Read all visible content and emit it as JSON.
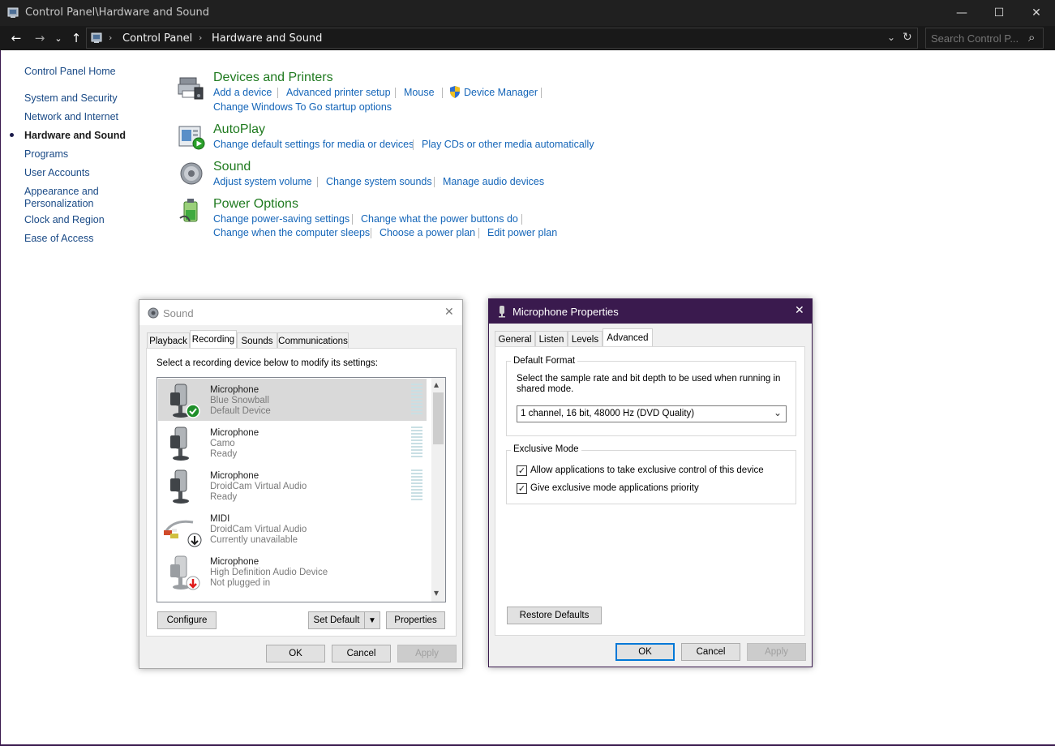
{
  "window": {
    "title": "Control Panel\\Hardware and Sound",
    "minimize_glyph": "—",
    "maximize_glyph": "☐",
    "close_glyph": "✕"
  },
  "addressbar": {
    "back_glyph": "←",
    "forward_glyph": "→",
    "recent_glyph": "⌄",
    "up_glyph": "↑",
    "crumbs": [
      "Control Panel",
      "Hardware and Sound"
    ],
    "crumb_sep": "›",
    "dropdown_glyph": "⌄",
    "refresh_glyph": "↻",
    "search_placeholder": "Search Control P...",
    "search_glyph": "⌕"
  },
  "nav": {
    "home": "Control Panel Home",
    "items": [
      "System and Security",
      "Network and Internet",
      "Hardware and Sound",
      "Programs",
      "User Accounts",
      "Appearance and",
      "Personalization",
      "Clock and Region",
      "Ease of Access"
    ]
  },
  "categories": {
    "devices": {
      "title": "Devices and Printers",
      "links": [
        "Add a device",
        "Advanced printer setup",
        "Mouse",
        "Device Manager",
        "Change Windows To Go startup options"
      ]
    },
    "autoplay": {
      "title": "AutoPlay",
      "links": [
        "Change default settings for media or devices",
        "Play CDs or other media automatically"
      ]
    },
    "sound": {
      "title": "Sound",
      "links": [
        "Adjust system volume",
        "Change system sounds",
        "Manage audio devices"
      ]
    },
    "power": {
      "title": "Power Options",
      "links": [
        "Change power-saving settings",
        "Change what the power buttons do",
        "Change when the computer sleeps",
        "Choose a power plan",
        "Edit power plan"
      ]
    }
  },
  "sound_dialog": {
    "title": "Sound",
    "close_glyph": "✕",
    "tabs": [
      "Playback",
      "Recording",
      "Sounds",
      "Communications"
    ],
    "instruction": "Select a recording device below to modify its settings:",
    "devices": [
      {
        "name": "Microphone",
        "desc": "Blue Snowball",
        "status": "Default Device"
      },
      {
        "name": "Microphone",
        "desc": "Camo",
        "status": "Ready"
      },
      {
        "name": "Microphone",
        "desc": "DroidCam Virtual Audio",
        "status": "Ready"
      },
      {
        "name": "MIDI",
        "desc": "DroidCam Virtual Audio",
        "status": "Currently unavailable"
      },
      {
        "name": "Microphone",
        "desc": "High Definition Audio Device",
        "status": "Not plugged in"
      }
    ],
    "buttons": {
      "configure": "Configure",
      "set_default": "Set Default",
      "properties": "Properties",
      "ok": "OK",
      "cancel": "Cancel",
      "apply": "Apply"
    },
    "scroll_up_glyph": "▴",
    "scroll_down_glyph": "▾",
    "split_arrow_glyph": "▼"
  },
  "mic_dialog": {
    "title": "Microphone Properties",
    "close_glyph": "✕",
    "tabs": [
      "General",
      "Listen",
      "Levels",
      "Advanced"
    ],
    "default_format": {
      "label": "Default Format",
      "description": "Select the sample rate and bit depth to be used when running in shared mode.",
      "selected": "1 channel, 16 bit, 48000 Hz (DVD Quality)",
      "dropdown_glyph": "⌄"
    },
    "exclusive_mode": {
      "label": "Exclusive Mode",
      "option1": "Allow applications to take exclusive control of this device",
      "option2": "Give exclusive mode applications priority",
      "check_glyph": "✓"
    },
    "buttons": {
      "restore": "Restore Defaults",
      "ok": "OK",
      "cancel": "Cancel",
      "apply": "Apply"
    },
    "accent_color": "#3a1a4e"
  }
}
